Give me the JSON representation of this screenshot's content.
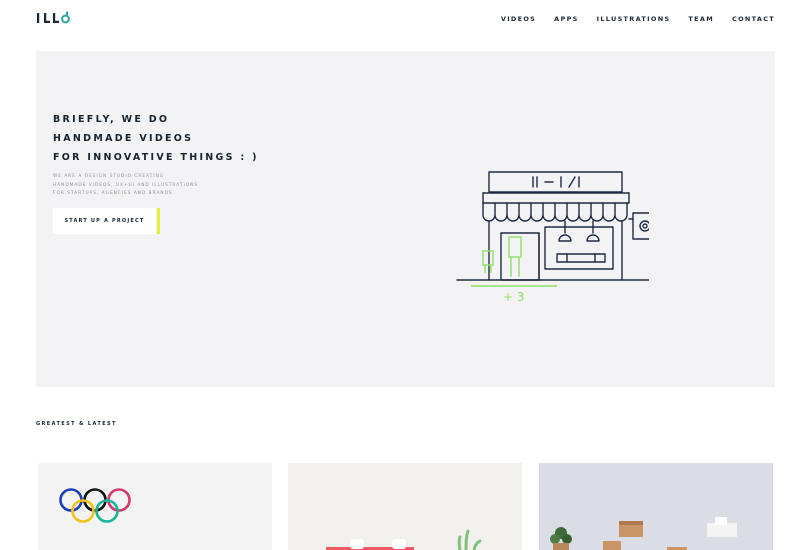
{
  "brand": {
    "logo_text": "ILLO"
  },
  "nav": {
    "items": [
      {
        "label": "VIDEOS"
      },
      {
        "label": "APPS"
      },
      {
        "label": "ILLUSTRATIONS"
      },
      {
        "label": "TEAM"
      },
      {
        "label": "CONTACT"
      }
    ]
  },
  "hero": {
    "headline": [
      "BRIEFLY, WE DO",
      "HANDMADE VIDEOS",
      "FOR INNOVATIVE THINGS : )"
    ],
    "description": [
      "WE ARE A DESIGN STUDIO CREATING",
      "HANDMADE VIDEOS, UX+UI AND ILLUSTRATIONS",
      "FOR STARTUPS, AGENCIES AND BRANDS"
    ],
    "cta_label": "START UP A PROJECT",
    "illustration": {
      "sign_text": "|| — |\\/|",
      "counter_text": "+ 3",
      "accent_color": "#8ee06a",
      "line_color": "#1f2a44"
    }
  },
  "work": {
    "section_label": "GREATEST & LATEST",
    "cards": [
      {
        "subject": "olympic-rings"
      },
      {
        "subject": "plant-and-red-box"
      },
      {
        "subject": "boxes-and-plant"
      }
    ]
  },
  "colors": {
    "hero_bg": "#f3f3f5",
    "cta_accent": "#e3f230",
    "text": "#15232f"
  }
}
